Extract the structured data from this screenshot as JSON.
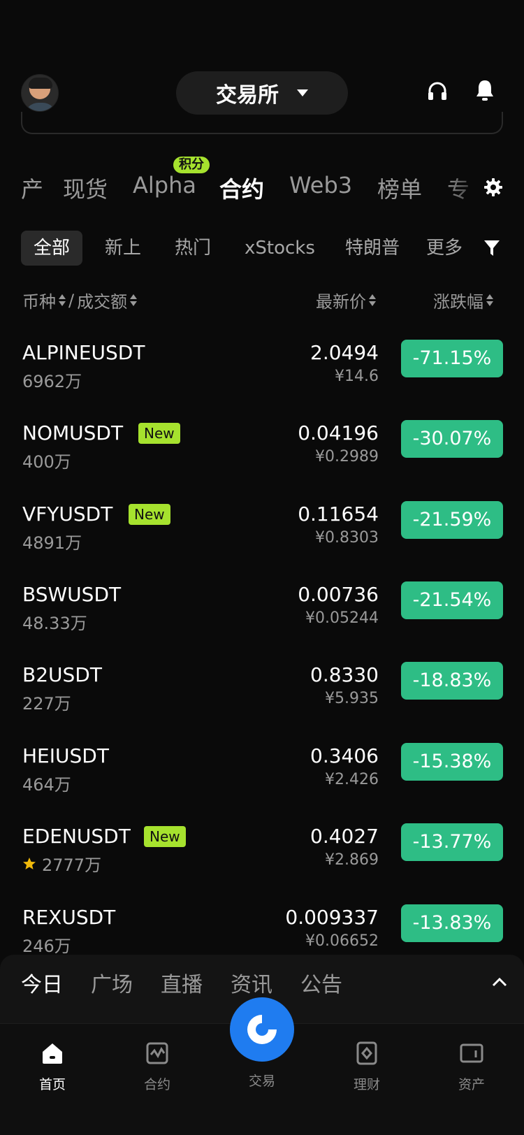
{
  "header": {
    "exchange_label": "交易所"
  },
  "main_tabs": [
    {
      "label": "产"
    },
    {
      "label": "现货"
    },
    {
      "label": "Alpha",
      "badge": "积分"
    },
    {
      "label": "合约",
      "active": true
    },
    {
      "label": "Web3"
    },
    {
      "label": "榜单"
    },
    {
      "label": "专"
    }
  ],
  "sub_tabs": [
    {
      "label": "全部",
      "active": true
    },
    {
      "label": "新上"
    },
    {
      "label": "热门"
    },
    {
      "label": "xStocks"
    },
    {
      "label": "特朗普"
    },
    {
      "label": "更多"
    }
  ],
  "columns": {
    "symbol": "币种",
    "sep": "/",
    "volume": "成交额",
    "price": "最新价",
    "change": "涨跌幅"
  },
  "rows": [
    {
      "symbol": "ALPINEUSDT",
      "new": "",
      "volume": "6962万",
      "starred": false,
      "price": "2.0494",
      "cny": "¥14.6",
      "change": "-71.15%"
    },
    {
      "symbol": "NOMUSDT",
      "new": "New",
      "volume": "400万",
      "starred": false,
      "price": "0.04196",
      "cny": "¥0.2989",
      "change": "-30.07%"
    },
    {
      "symbol": "VFYUSDT",
      "new": "New",
      "volume": "4891万",
      "starred": false,
      "price": "0.11654",
      "cny": "¥0.8303",
      "change": "-21.59%"
    },
    {
      "symbol": "BSWUSDT",
      "new": "",
      "volume": "48.33万",
      "starred": false,
      "price": "0.00736",
      "cny": "¥0.05244",
      "change": "-21.54%"
    },
    {
      "symbol": "B2USDT",
      "new": "",
      "volume": "227万",
      "starred": false,
      "price": "0.8330",
      "cny": "¥5.935",
      "change": "-18.83%"
    },
    {
      "symbol": "HEIUSDT",
      "new": "",
      "volume": "464万",
      "starred": false,
      "price": "0.3406",
      "cny": "¥2.426",
      "change": "-15.38%"
    },
    {
      "symbol": "EDENUSDT",
      "new": "New",
      "volume": "2777万",
      "starred": true,
      "price": "0.4027",
      "cny": "¥2.869",
      "change": "-13.77%"
    },
    {
      "symbol": "REXUSDT",
      "new": "",
      "volume": "246万",
      "starred": false,
      "price": "0.009337",
      "cny": "¥0.06652",
      "change": "-13.83%"
    }
  ],
  "news_tabs": [
    {
      "label": "今日",
      "active": true
    },
    {
      "label": "广场"
    },
    {
      "label": "直播"
    },
    {
      "label": "资讯"
    },
    {
      "label": "公告"
    }
  ],
  "bottom_nav": {
    "home": "首页",
    "futures": "合约",
    "trade": "交易",
    "earn": "理财",
    "assets": "资产"
  },
  "colors": {
    "down": "#2ebd85",
    "badge": "#a6e22e",
    "fab": "#1f7cf0",
    "background": "#0a0a0a"
  },
  "icons": [
    "avatar",
    "headset-icon",
    "bell-icon",
    "gear-icon",
    "filter-icon",
    "sort-icon",
    "star-icon",
    "chevron-up-icon",
    "home-icon",
    "futures-icon",
    "trade-icon",
    "earn-icon",
    "assets-icon"
  ]
}
